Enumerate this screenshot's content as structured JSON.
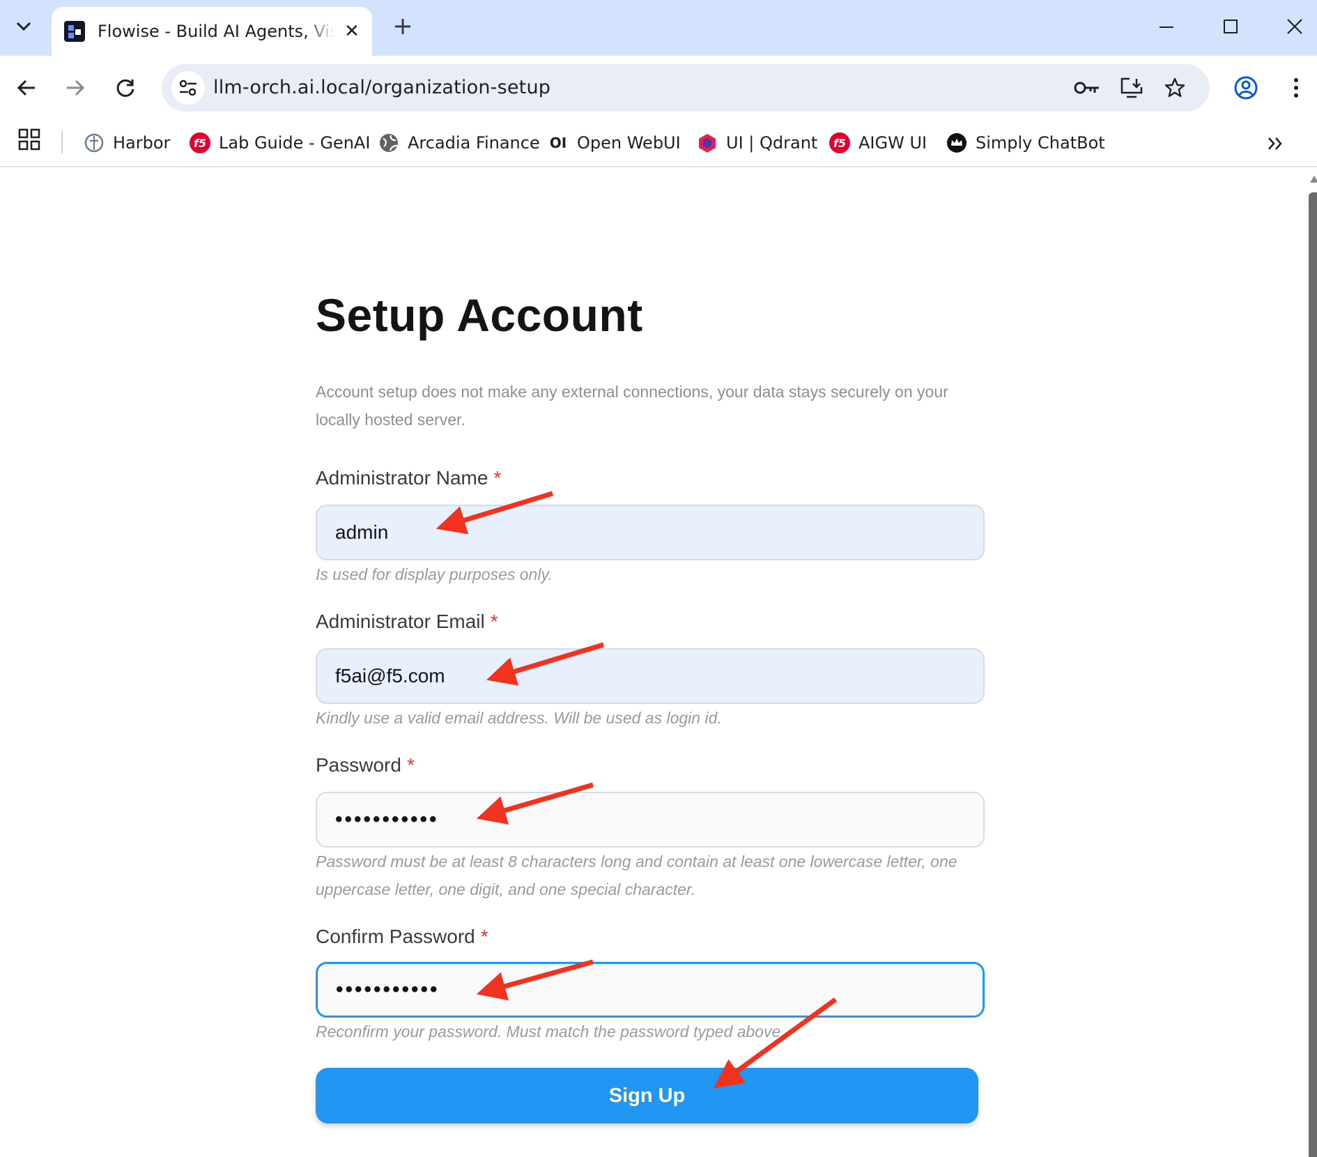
{
  "browser": {
    "tab_title": "Flowise - Build AI Agents, Visual",
    "url": "llm-orch.ai.local/organization-setup",
    "bookmarks": [
      {
        "label": "Harbor",
        "icon": "harbor-icon"
      },
      {
        "label": "Lab Guide - GenAI",
        "icon": "f5-icon"
      },
      {
        "label": "Arcadia Finance",
        "icon": "globe-icon"
      },
      {
        "label": "Open WebUI",
        "icon": "openwebui-icon"
      },
      {
        "label": "UI | Qdrant",
        "icon": "qdrant-icon"
      },
      {
        "label": "AIGW UI",
        "icon": "f5-icon"
      },
      {
        "label": "Simply ChatBot",
        "icon": "crown-icon"
      }
    ],
    "f5_logo_text": "f5"
  },
  "form": {
    "title": "Setup Account",
    "description": "Account setup does not make any external connections, your data stays securely on your locally hosted server.",
    "required_mark": "*",
    "fields": {
      "name": {
        "label": "Administrator Name",
        "value": "admin",
        "hint": "Is used for display purposes only."
      },
      "email": {
        "label": "Administrator Email",
        "value": "f5ai@f5.com",
        "hint": "Kindly use a valid email address. Will be used as login id."
      },
      "password": {
        "label": "Password",
        "value": "•••••••••••",
        "hint": "Password must be at least 8 characters long and contain at least one lowercase letter, one uppercase letter, one digit, and one special character."
      },
      "confirm": {
        "label": "Confirm Password",
        "value": "•••••••••••",
        "hint": "Reconfirm your password. Must match the password typed above."
      }
    },
    "submit_label": "Sign Up"
  },
  "colors": {
    "accent": "#2196f3",
    "annotation_arrow": "#f0321e",
    "required": "#e53935",
    "tabstrip": "#d3e3fd"
  }
}
